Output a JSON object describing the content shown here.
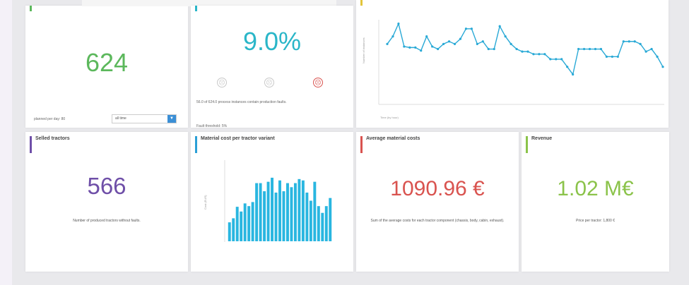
{
  "cards": {
    "planned": {
      "value": "624",
      "footer": "planned per day: 80",
      "filter_label": "all time",
      "accent": "#5cb85c"
    },
    "defect_rate": {
      "value": "9.0%",
      "note": "56.0 of 624.0 process instances contain production faults.",
      "threshold": "Fault threshold: 5%",
      "accent": "#2ab6c8",
      "icons": [
        "neutral-face-icon",
        "neutral-face-icon",
        "sad-face-icon"
      ]
    },
    "timeline": {
      "accent": "#e2c53b",
      "xlabel": "Time (by hour)",
      "ylabel": "Number of instances"
    },
    "sold": {
      "title": "Selled tractors",
      "value": "566",
      "note": "Number of produced tractors without faults.",
      "accent": "#6f4fa8"
    },
    "material": {
      "title": "Material cost per tractor variant",
      "accent": "#2a9fd6",
      "ylabel": "Cost (EUR)"
    },
    "avg_cost": {
      "title": "Average material costs",
      "value": "1090.96 €",
      "note": "Sum of the average costs for each tractor component (chassis, body, cabin, exhaust).",
      "accent": "#d9534f"
    },
    "revenue": {
      "title": "Revenue",
      "value": "1.02 M€",
      "note": "Price per tractor: 1,800 €",
      "accent": "#8bc34a"
    }
  },
  "chart_data": [
    {
      "type": "line",
      "color": "#29a9d6",
      "x": [
        1,
        2,
        3,
        4,
        5,
        6,
        7,
        8,
        9,
        10,
        11,
        12,
        13,
        14,
        15,
        16,
        17,
        18,
        19,
        20,
        21,
        22,
        23,
        24,
        25,
        26,
        27,
        28,
        29,
        30,
        31,
        32,
        33,
        34,
        35,
        36,
        37,
        38,
        39,
        40,
        41,
        42,
        43,
        44,
        45,
        46,
        47,
        48,
        49,
        50
      ],
      "values": [
        11.5,
        13,
        15.5,
        11,
        10.8,
        10.8,
        10.2,
        13,
        11,
        10.5,
        11.5,
        12,
        11.5,
        12.5,
        14.5,
        14.5,
        11.5,
        12,
        10.5,
        10.5,
        15,
        13,
        11.5,
        10.5,
        10,
        10,
        9.5,
        9.5,
        9.5,
        8.5,
        8.5,
        8.5,
        7,
        5.5,
        10.5,
        10.5,
        10.5,
        10.5,
        10.5,
        9,
        9,
        9,
        12,
        12,
        12,
        11.5,
        10,
        10.5,
        9,
        7
      ],
      "ylim": [
        0,
        16
      ]
    },
    {
      "type": "bar",
      "color": "#29b6e0",
      "values": [
        280,
        340,
        510,
        440,
        560,
        520,
        580,
        860,
        860,
        740,
        880,
        940,
        720,
        900,
        740,
        860,
        800,
        860,
        920,
        900,
        720,
        600,
        880,
        520,
        420,
        520,
        640
      ],
      "ylim": [
        0,
        1200
      ]
    }
  ]
}
